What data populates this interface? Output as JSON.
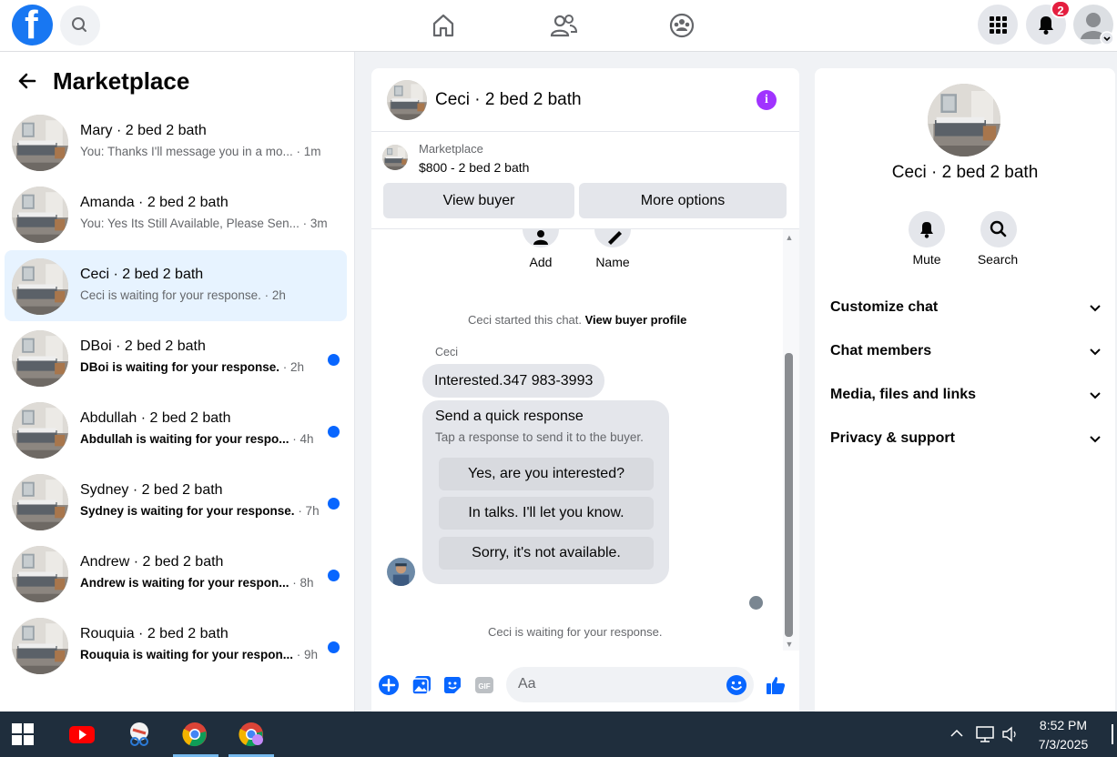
{
  "topbar": {
    "notification_count": "2"
  },
  "left": {
    "title": "Marketplace",
    "conversations": [
      {
        "name": "Mary · 2 bed 2 bath",
        "preview": "You: Thanks I'll message you in a mo...",
        "time": " · 1m",
        "unread": false,
        "active": false
      },
      {
        "name": "Amanda · 2 bed 2 bath",
        "preview": "You: Yes Its Still Available, Please Sen...",
        "time": " · 3m",
        "unread": false,
        "active": false
      },
      {
        "name": "Ceci · 2 bed 2 bath",
        "preview": "Ceci is waiting for your response.",
        "time": " · 2h",
        "unread": false,
        "active": true
      },
      {
        "name": "DBoi · 2 bed 2 bath",
        "preview": "DBoi is waiting for your response.",
        "time": " · 2h",
        "unread": true,
        "active": false
      },
      {
        "name": "Abdullah · 2 bed 2 bath",
        "preview": "Abdullah is waiting for your respo...",
        "time": " · 4h",
        "unread": true,
        "active": false
      },
      {
        "name": "Sydney · 2 bed 2 bath",
        "preview": "Sydney is waiting for your response.",
        "time": " · 7h",
        "unread": true,
        "active": false
      },
      {
        "name": "Andrew · 2 bed 2 bath",
        "preview": "Andrew is waiting for your respon...",
        "time": " · 8h",
        "unread": true,
        "active": false
      },
      {
        "name": "Rouquia · 2 bed 2 bath",
        "preview": "Rouquia is waiting for your respon...",
        "time": " · 9h",
        "unread": true,
        "active": false
      }
    ]
  },
  "chat": {
    "title": "Ceci · 2 bed 2 bath",
    "marketplace_label": "Marketplace",
    "listing": "$800 - 2 bed 2 bath",
    "view_buyer": "View buyer",
    "more_options": "More options",
    "add_label": "Add",
    "name_label": "Name",
    "started_text": "Ceci started this chat. ",
    "view_profile": "View buyer profile",
    "sender": "Ceci",
    "message": "Interested.347 983-3993",
    "quick_title": "Send a quick response",
    "quick_sub": "Tap a response to send it to the buyer.",
    "quick_replies": [
      "Yes, are you interested?",
      "In talks. I'll let you know.",
      "Sorry, it's not available."
    ],
    "waiting": "Ceci is waiting for your response.",
    "composer_placeholder": "Aa"
  },
  "details": {
    "name": "Ceci · 2 bed 2 bath",
    "mute": "Mute",
    "search": "Search",
    "sections": [
      "Customize chat",
      "Chat members",
      "Media, files and links",
      "Privacy & support"
    ]
  },
  "taskbar": {
    "time": "8:52 PM",
    "date": "7/3/2025"
  },
  "colors": {
    "brand": "#1877f2",
    "unread_dot": "#0866ff",
    "active_bg": "#e7f3ff",
    "info": "#a033ff"
  }
}
